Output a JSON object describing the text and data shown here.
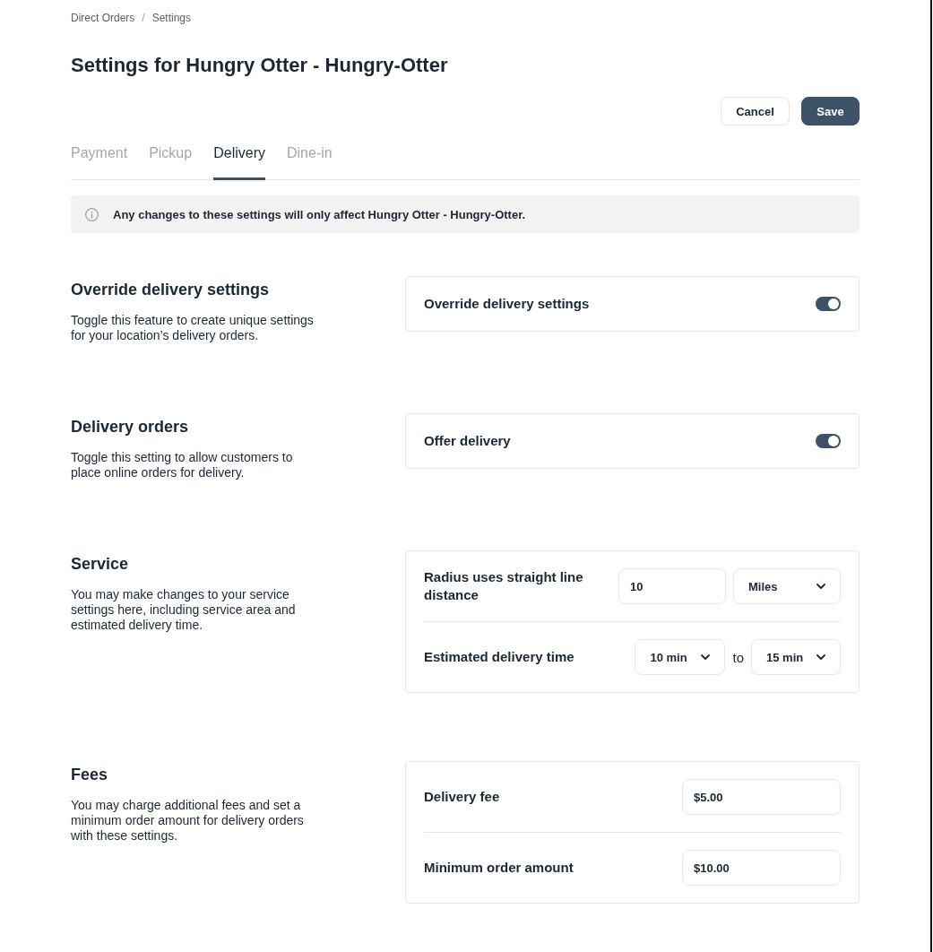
{
  "breadcrumb": {
    "items": [
      "Direct Orders",
      "Settings"
    ],
    "separator": "/"
  },
  "page_title": "Settings for Hungry Otter - Hungry-Otter",
  "actions": [
    {
      "label": "Cancel",
      "kind": "secondary"
    },
    {
      "label": "Save",
      "kind": "primary"
    }
  ],
  "tabs": [
    {
      "label": "Payment",
      "selected": false
    },
    {
      "label": "Pickup",
      "selected": false
    },
    {
      "label": "Delivery",
      "selected": true
    },
    {
      "label": "Dine-in",
      "selected": false
    }
  ],
  "notice": "Any changes to these settings will only affect Hungry Otter - Hungry-Otter.",
  "sections": [
    {
      "title": "Override delivery settings",
      "description": "Toggle this feature to create unique settings for your location’s delivery orders.",
      "rows": [
        {
          "kind": "switch",
          "label": "Override delivery settings",
          "on": true
        }
      ]
    },
    {
      "title": "Delivery orders",
      "description": "Toggle this setting to allow customers to place online orders for delivery.",
      "rows": [
        {
          "kind": "switch",
          "label": "Offer delivery",
          "on": true
        }
      ]
    },
    {
      "title": "Service",
      "description": "You may make changes to your service settings here, including service area and estimated delivery time.",
      "rows": [
        {
          "kind": "distance",
          "label": "Radius uses straight line distance",
          "value": "10",
          "unit": "Miles"
        },
        {
          "kind": "time_range",
          "label": "Estimated delivery time",
          "from": "10 min",
          "joiner": "to",
          "to": "15 min"
        }
      ]
    },
    {
      "title": "Fees",
      "description": "You may charge additional fees and set a minimum order amount for delivery orders with these settings.",
      "rows": [
        {
          "kind": "amount",
          "label": "Delivery fee",
          "value": "$5.00"
        },
        {
          "kind": "amount",
          "label": "Minimum order amount",
          "value": "$10.00"
        }
      ]
    }
  ]
}
